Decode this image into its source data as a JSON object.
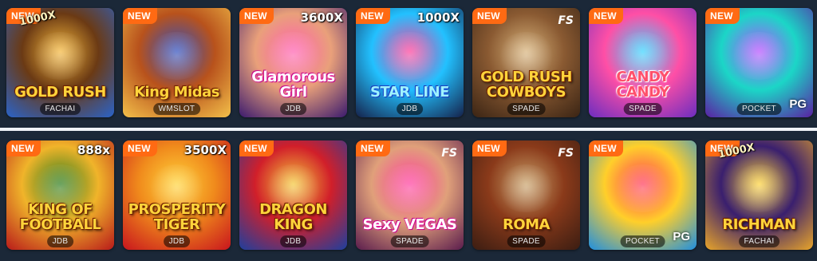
{
  "rows": [
    [
      {
        "title": "GOLD RUSH",
        "new": "NEW",
        "multiplier": "1000X",
        "provider": "FACHAI",
        "fs": "",
        "pg": "",
        "colors": [
          "#2a63c9",
          "#6b3a14",
          "#f5b73b"
        ]
      },
      {
        "title": "King Midas",
        "new": "NEW",
        "multiplier": "",
        "provider": "WMSLOT",
        "fs": "",
        "pg": "",
        "colors": [
          "#f3c04a",
          "#b8521c",
          "#2f4fbf"
        ]
      },
      {
        "title": "Glamorous Girl",
        "new": "NEW",
        "multiplier": "3600X",
        "provider": "JDB",
        "fs": "",
        "pg": "",
        "colors": [
          "#3b1a6e",
          "#e9a07a",
          "#ff5fb0"
        ]
      },
      {
        "title": "STAR LINE",
        "new": "NEW",
        "multiplier": "1000X",
        "provider": "JDB",
        "fs": "",
        "pg": "",
        "colors": [
          "#15214a",
          "#22c1ff",
          "#ff3f9a"
        ]
      },
      {
        "title": "GOLD RUSH COWBOYS",
        "new": "NEW",
        "multiplier": "",
        "provider": "SPADE",
        "fs": "FS",
        "pg": "",
        "colors": [
          "#3a2414",
          "#8a5a32",
          "#d7b27a"
        ]
      },
      {
        "title": "CANDY CANDY",
        "new": "NEW",
        "multiplier": "",
        "provider": "SPADE",
        "fs": "",
        "pg": "",
        "colors": [
          "#6b2dbf",
          "#ff4fa6",
          "#38d4ff"
        ]
      },
      {
        "title": "",
        "new": "NEW",
        "multiplier": "",
        "provider": "POCKET",
        "fs": "",
        "pg": "PG",
        "colors": [
          "#5a1fa3",
          "#1bd6c7",
          "#b64fff"
        ]
      }
    ],
    [
      {
        "title": "KING OF FOOTBALL",
        "new": "NEW",
        "multiplier": "888x",
        "provider": "JDB",
        "fs": "",
        "pg": "",
        "colors": [
          "#b81a1a",
          "#f0b42a",
          "#2d7d1e"
        ]
      },
      {
        "title": "PROSPERITY TIGER",
        "new": "NEW",
        "multiplier": "3500X",
        "provider": "JDB",
        "fs": "",
        "pg": "",
        "colors": [
          "#c8151d",
          "#f08a1c",
          "#ffd43b"
        ]
      },
      {
        "title": "DRAGON KING",
        "new": "NEW",
        "multiplier": "",
        "provider": "JDB",
        "fs": "",
        "pg": "",
        "colors": [
          "#1d3f9e",
          "#d11f2a",
          "#f4c83a"
        ]
      },
      {
        "title": "Sexy VEGAS",
        "new": "NEW",
        "multiplier": "",
        "provider": "SPADE",
        "fs": "FS",
        "pg": "",
        "colors": [
          "#5a1c4d",
          "#e0a07a",
          "#ff3fa0"
        ]
      },
      {
        "title": "ROMA",
        "new": "NEW",
        "multiplier": "",
        "provider": "SPADE",
        "fs": "FS",
        "pg": "",
        "colors": [
          "#3b1d12",
          "#8a3a1a",
          "#c9a26a"
        ]
      },
      {
        "title": "",
        "new": "NEW",
        "multiplier": "",
        "provider": "POCKET",
        "fs": "",
        "pg": "PG",
        "colors": [
          "#1f8fe0",
          "#ffcf2a",
          "#ff3b5c"
        ]
      },
      {
        "title": "RICHMAN",
        "new": "NEW",
        "multiplier": "1000X",
        "provider": "FACHAI",
        "fs": "",
        "pg": "",
        "colors": [
          "#e8a52a",
          "#3a1f6e",
          "#ffd43b"
        ]
      }
    ]
  ]
}
